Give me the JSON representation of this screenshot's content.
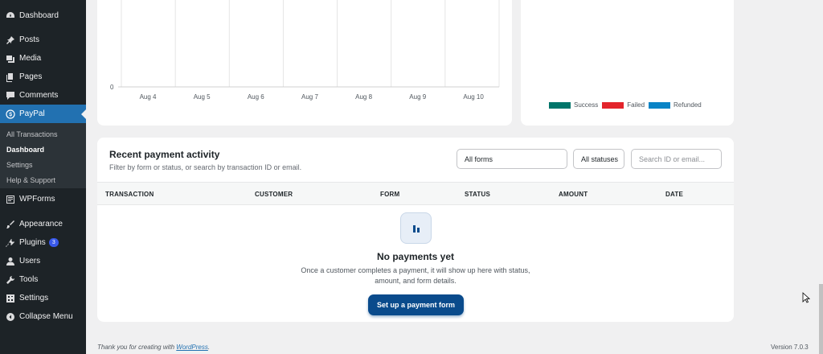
{
  "sidebar": {
    "items": [
      {
        "label": "Dashboard",
        "icon": "dashboard-icon"
      },
      {
        "label": "Posts",
        "icon": "pin-icon"
      },
      {
        "label": "Media",
        "icon": "media-icon"
      },
      {
        "label": "Pages",
        "icon": "pages-icon"
      },
      {
        "label": "Comments",
        "icon": "comment-icon"
      },
      {
        "label": "PayPal",
        "icon": "dollar-icon",
        "active": true
      },
      {
        "label": "WPForms",
        "icon": "forms-icon"
      },
      {
        "label": "Appearance",
        "icon": "brush-icon"
      },
      {
        "label": "Plugins",
        "icon": "plugin-icon",
        "badge": "3"
      },
      {
        "label": "Users",
        "icon": "user-icon"
      },
      {
        "label": "Tools",
        "icon": "wrench-icon"
      },
      {
        "label": "Settings",
        "icon": "settings-icon"
      },
      {
        "label": "Collapse Menu",
        "icon": "collapse-icon"
      }
    ],
    "submenu": [
      {
        "label": "All Transactions"
      },
      {
        "label": "Dashboard",
        "current": true
      },
      {
        "label": "Settings"
      },
      {
        "label": "Help & Support"
      }
    ]
  },
  "chart_data": {
    "type": "line",
    "categories": [
      "Aug 4",
      "Aug 5",
      "Aug 6",
      "Aug 7",
      "Aug 8",
      "Aug 9",
      "Aug 10"
    ],
    "y_tick_labels": [
      "0"
    ],
    "series": [
      {
        "name": "Success",
        "values": [
          0,
          0,
          0,
          0,
          0,
          0,
          0
        ],
        "color": "#00756a"
      },
      {
        "name": "Failed",
        "values": [
          0,
          0,
          0,
          0,
          0,
          0,
          0
        ],
        "color": "#e3242b"
      },
      {
        "name": "Refunded",
        "values": [
          0,
          0,
          0,
          0,
          0,
          0,
          0
        ],
        "color": "#0a84c6"
      }
    ],
    "grid": true
  },
  "legend": [
    {
      "label": "Success",
      "color": "#00756a"
    },
    {
      "label": "Failed",
      "color": "#e3242b"
    },
    {
      "label": "Refunded",
      "color": "#0a84c6"
    }
  ],
  "activity": {
    "title": "Recent payment activity",
    "subtitle": "Filter by form or status, or search by transaction ID or email.",
    "forms_select": "All forms",
    "status_select": "All statuses",
    "search_placeholder": "Search ID or email...",
    "columns": [
      "TRANSACTION",
      "CUSTOMER",
      "FORM",
      "STATUS",
      "AMOUNT",
      "DATE"
    ],
    "empty_title": "No payments yet",
    "empty_desc": "Once a customer completes a payment, it will show up here with status, amount, and form details.",
    "cta": "Set up a payment form"
  },
  "footer": {
    "thanks": "Thank you for creating with ",
    "link": "WordPress",
    "period": ".",
    "version": "Version 7.0.3"
  }
}
